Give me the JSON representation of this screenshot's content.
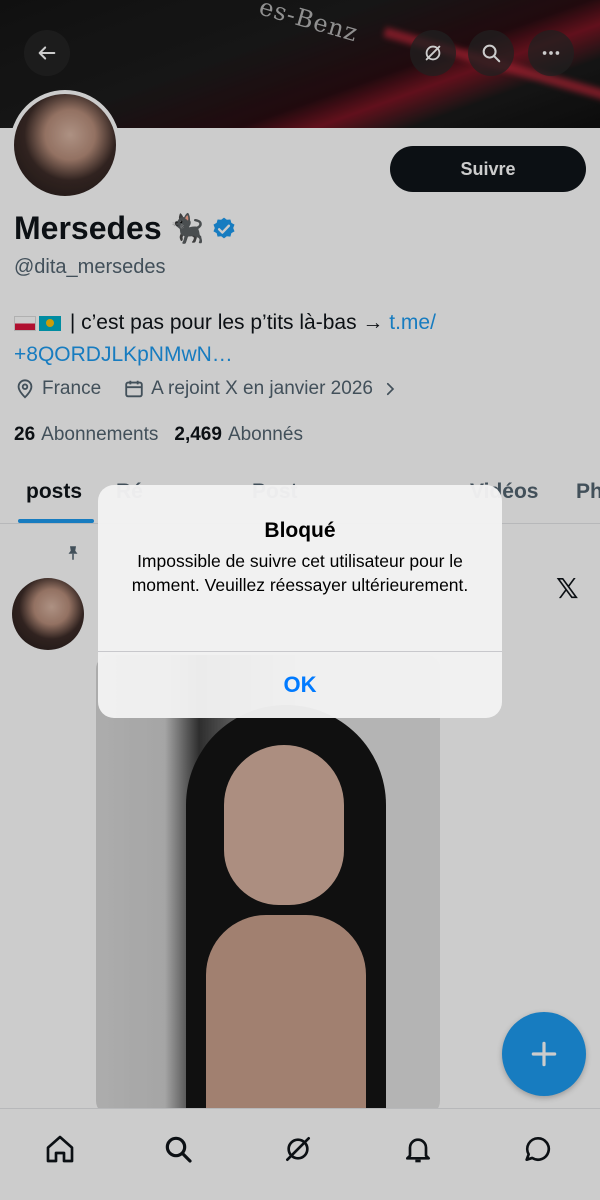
{
  "banner": {
    "text": "es-Benz"
  },
  "profile": {
    "follow_label": "Suivre",
    "name": "Mersedes",
    "name_emoji": "🐈‍⬛",
    "handle": "@dita_mersedes",
    "bio_text": " | c’est pas pour les p’tits là-bas → ",
    "bio_link_1": "t.me/",
    "bio_link_2": "+8QORDJLKpNMwN…",
    "location": "France",
    "joined": "A rejoint X en janvier 2026",
    "following_count": "26",
    "following_label": "Abonnements",
    "followers_count": "2,469",
    "followers_label": "Abonnés"
  },
  "tabs": [
    {
      "label": "posts"
    },
    {
      "label": "Ré"
    },
    {
      "label": "Post"
    },
    {
      "label": "Vidéos"
    },
    {
      "label": "Ph"
    }
  ],
  "post": {
    "logo": "𝕏"
  },
  "alert": {
    "title": "Bloqué",
    "message": "Impossible de suivre cet utilisateur pour le moment. Veuillez réessayer ultérieurement.",
    "ok_label": "OK"
  },
  "icons": {
    "back": "back-arrow-icon",
    "grok": "grok-icon",
    "search": "search-icon",
    "more": "more-icon",
    "location": "location-icon",
    "calendar": "calendar-icon",
    "pin": "pin-icon",
    "compose": "plus-icon",
    "nav": [
      "home-icon",
      "search-icon",
      "grok-icon",
      "bell-icon",
      "chat-icon"
    ]
  },
  "colors": {
    "accent": "#1d9bf0",
    "ios_blue": "#007aff",
    "dark": "#0f1419"
  }
}
